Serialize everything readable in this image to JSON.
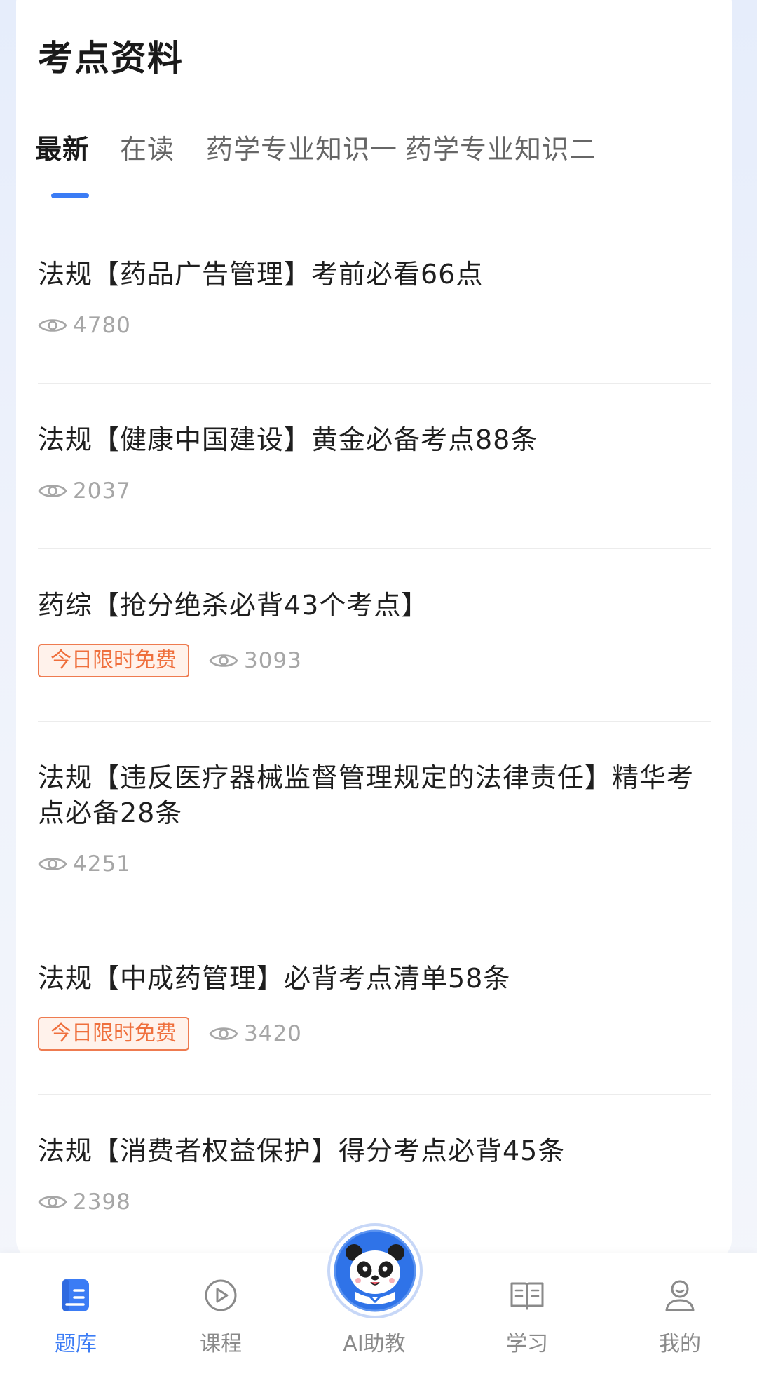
{
  "page": {
    "title": "考点资料"
  },
  "tabs": [
    {
      "label": "最新",
      "active": true
    },
    {
      "label": "在读",
      "active": false
    },
    {
      "label": "药学专业知识一",
      "active": false
    },
    {
      "label": "药学专业知识二",
      "active": false
    }
  ],
  "articles": [
    {
      "title": "法规【药品广告管理】考前必看66点",
      "badge": "",
      "views": "4780"
    },
    {
      "title": "法规【健康中国建设】黄金必备考点88条",
      "badge": "",
      "views": "2037"
    },
    {
      "title": "药综【抢分绝杀必背43个考点】",
      "badge": "今日限时免费",
      "views": "3093"
    },
    {
      "title": "法规【违反医疗器械监督管理规定的法律责任】精华考点必备28条",
      "badge": "",
      "views": "4251"
    },
    {
      "title": "法规【中成药管理】必背考点清单58条",
      "badge": "今日限时免费",
      "views": "3420"
    },
    {
      "title": "法规【消费者权益保护】得分考点必背45条",
      "badge": "",
      "views": "2398"
    }
  ],
  "bottom_nav": [
    {
      "label": "题库",
      "icon": "question-bank-icon",
      "active": true
    },
    {
      "label": "课程",
      "icon": "play-course-icon",
      "active": false
    },
    {
      "label": "AI助教",
      "icon": "panda-ai-assistant-icon",
      "active": false
    },
    {
      "label": "学习",
      "icon": "open-book-icon",
      "active": false
    },
    {
      "label": "我的",
      "icon": "user-profile-icon",
      "active": false
    }
  ],
  "colors": {
    "accent": "#3b7cf5",
    "badge_text": "#ef6f3c",
    "badge_border": "#ee7b50",
    "badge_bg": "#fff2eb",
    "meta_gray": "#a6a6a6"
  }
}
